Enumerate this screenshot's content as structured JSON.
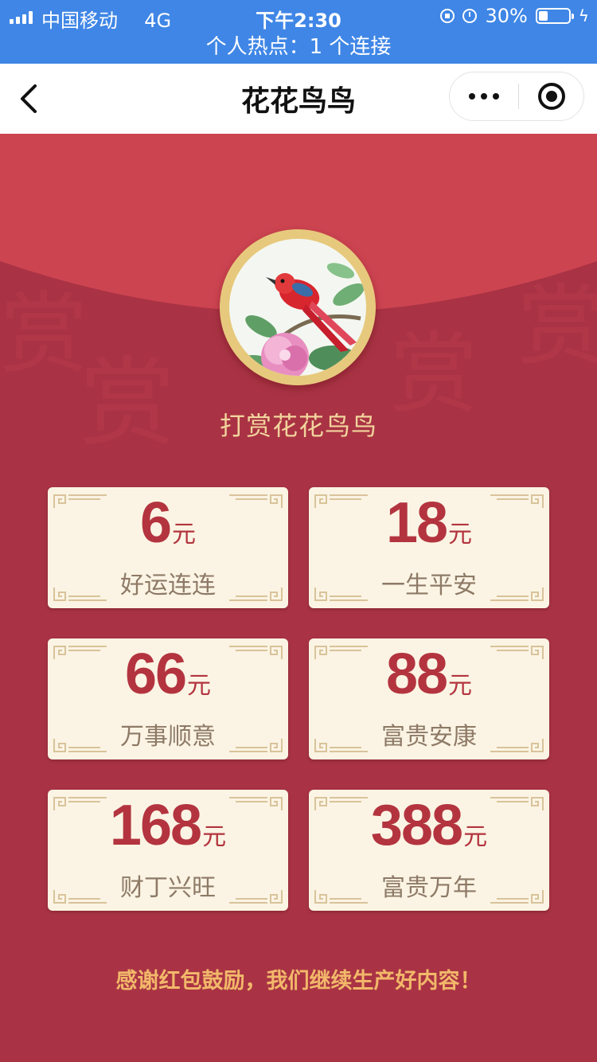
{
  "status_bar": {
    "carrier": "中国移动",
    "network": "4G",
    "time": "下午2:30",
    "battery_percent": "30%",
    "battery_level": 0.3,
    "icons": [
      "signal-icon",
      "rotation-lock-icon",
      "alarm-icon",
      "battery-icon",
      "charging-bolt-icon"
    ]
  },
  "hotspot": {
    "text": "个人热点：1 个连接"
  },
  "nav": {
    "title": "花花鸟鸟",
    "icons": [
      "back-arrow-icon",
      "more-dots-icon",
      "close-miniprogram-icon"
    ]
  },
  "reward": {
    "title": "打赏花花鸟鸟",
    "options": [
      {
        "amount": "6",
        "unit": "元",
        "label": "好运连连"
      },
      {
        "amount": "18",
        "unit": "元",
        "label": "一生平安"
      },
      {
        "amount": "66",
        "unit": "元",
        "label": "万事顺意"
      },
      {
        "amount": "88",
        "unit": "元",
        "label": "富贵安康"
      },
      {
        "amount": "168",
        "unit": "元",
        "label": "财丁兴旺"
      },
      {
        "amount": "388",
        "unit": "元",
        "label": "富贵万年"
      }
    ],
    "thanks": "感谢红包鼓励，我们继续生产好内容！",
    "background_glyph": "赏"
  },
  "colors": {
    "status_bar_bg": "#3f86e6",
    "envelope_red": "#a93344",
    "flap_red": "#cd4451",
    "gold": "#e7c97d",
    "title_gold": "#f2d49d",
    "card_bg": "#fbf4e4",
    "amount_red": "#b3343f",
    "thanks_orange": "#f2b86a"
  }
}
